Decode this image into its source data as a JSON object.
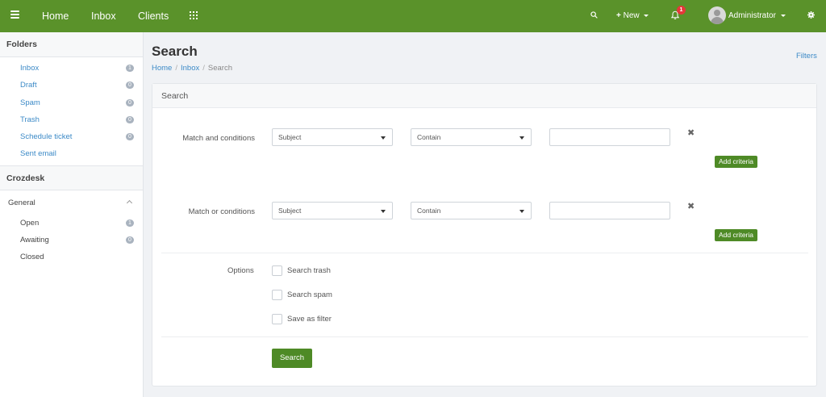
{
  "topnav": {
    "links": [
      "Home",
      "Inbox",
      "Clients"
    ],
    "new_label": "New",
    "notifications_count": "1",
    "user_name": "Administrator",
    "brand_color": "#5a922a"
  },
  "sidebar": {
    "folders_title": "Folders",
    "folders": [
      {
        "label": "Inbox",
        "count": "1"
      },
      {
        "label": "Draft",
        "count": "0"
      },
      {
        "label": "Spam",
        "count": "0"
      },
      {
        "label": "Trash",
        "count": "0"
      },
      {
        "label": "Schedule ticket",
        "count": "0"
      },
      {
        "label": "Sent email",
        "count": ""
      }
    ],
    "section_title": "Crozdesk",
    "group_label": "General",
    "group_items": [
      {
        "label": "Open",
        "count": "1"
      },
      {
        "label": "Awaiting",
        "count": "0"
      },
      {
        "label": "Closed",
        "count": ""
      }
    ]
  },
  "page": {
    "title": "Search",
    "breadcrumb": [
      "Home",
      "Inbox",
      "Search"
    ],
    "filters_link": "Filters"
  },
  "panel": {
    "title": "Search",
    "and_label": "Match and conditions",
    "or_label": "Match or conditions",
    "field_value": "Subject",
    "operator_value": "Contain",
    "remove_glyph": "✖",
    "add_criteria": "Add criteria",
    "options_label": "Options",
    "options": [
      "Search trash",
      "Search spam",
      "Save as filter"
    ],
    "search_button": "Search",
    "accent_color": "#4e8a26"
  }
}
